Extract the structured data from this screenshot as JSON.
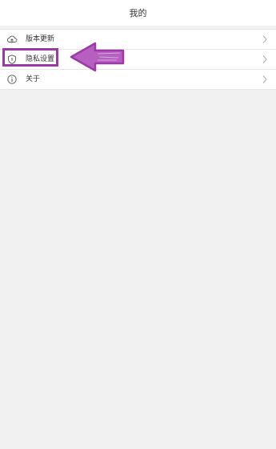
{
  "header": {
    "title": "我的"
  },
  "menu": {
    "items": [
      {
        "label": "版本更新",
        "icon": "cloud-upload-icon"
      },
      {
        "label": "隐私设置",
        "icon": "shield-info-icon"
      },
      {
        "label": "关于",
        "icon": "info-circle-icon"
      }
    ]
  },
  "annotation": {
    "color": "#9b3aa6"
  }
}
